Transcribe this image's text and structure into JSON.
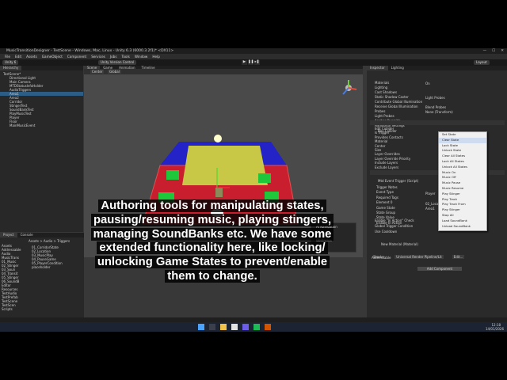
{
  "window": {
    "title": "MusicTransitionDesigner - TestScene - Windows, Mac, Linux - Unity 6.3 (6000.3.2f1)* <DX11>",
    "minimize": "—",
    "maximize": "☐",
    "close": "✕"
  },
  "menu": [
    "File",
    "Edit",
    "Assets",
    "GameObject",
    "Component",
    "Services",
    "Jobs",
    "Tools",
    "Window",
    "Help"
  ],
  "toolbar": {
    "unity_label": "Unity 6",
    "vc_label": "Unity Version Control",
    "layout_label": "Layout"
  },
  "hierarchy": {
    "tab": "Hierarchy",
    "items": [
      {
        "label": "TestScene*",
        "selected": false
      },
      {
        "label": "Directional Light",
        "selected": false
      },
      {
        "label": "Main Camera",
        "selected": false
      },
      {
        "label": "MTDStatusInfoHolder",
        "selected": false
      },
      {
        "label": "AudioTriggers",
        "selected": false
      },
      {
        "label": "Area1",
        "selected": true
      },
      {
        "label": "Area2",
        "selected": false
      },
      {
        "label": "Corridor",
        "selected": false
      },
      {
        "label": "StingerTest",
        "selected": false
      },
      {
        "label": "SoundBankTest",
        "selected": false
      },
      {
        "label": "PlayMusicTest",
        "selected": false
      },
      {
        "label": "Player",
        "selected": false
      },
      {
        "label": "Floor",
        "selected": false
      },
      {
        "label": "MainMusicEvent",
        "selected": false
      }
    ]
  },
  "scene": {
    "tabs": [
      "Scene",
      "Game",
      "Animation",
      "Timeline"
    ],
    "shading_mode": "Center",
    "space_mode": "Global",
    "overlay": {
      "title": "AI Navigation",
      "items": [
        "Surfaces",
        "Agents",
        "Obstacles"
      ]
    },
    "colors": {
      "background": "#4a4a4a",
      "blue": "#2323c8",
      "red": "#c81e2d",
      "yellow": "#c8c846",
      "green": "#1fc83a"
    }
  },
  "project": {
    "tabs": [
      "Project",
      "Console"
    ],
    "breadcrumb": "Assets > Audio > Triggers",
    "tree": [
      "Assets",
      "Addressable",
      "Audio",
      "MusicTrans",
      "01_Music",
      "02_Stinger",
      "03_Soun",
      "04_Transit",
      "05_Stinger",
      "06_SoundB",
      "Editor",
      "Resources",
      "TestAudio",
      "TestPrefab",
      "TestScene",
      "TestScen",
      "Scripts"
    ],
    "files": [
      "01_CorridorState",
      "02_Location",
      "03_MusicPlay",
      "04_PauseGame",
      "05_PlayerCondition",
      "placeholder"
    ]
  },
  "inspector": {
    "tabs": [
      "Inspector",
      "Lighting"
    ],
    "sections": [
      {
        "label": "Materials",
        "value": ""
      },
      {
        "label": "Lighting",
        "value": ""
      },
      {
        "label": "Cast Shadows",
        "value": "On"
      },
      {
        "label": "Static Shadow Caster",
        "value": ""
      },
      {
        "label": "Contribute Global Illumination",
        "value": ""
      },
      {
        "label": "Receive Global Illumination",
        "value": "Light Probes"
      },
      {
        "label": "Probes",
        "value": ""
      },
      {
        "label": "Light Probes",
        "value": "Blend Probes"
      },
      {
        "label": "Anchor Override",
        "value": "None (Transform)"
      },
      {
        "label": "Additional Settings",
        "value": ""
      }
    ],
    "box_collider": {
      "title": "Box Collider",
      "fields": [
        "Edit Collider",
        "Is Trigger",
        "Provides Contacts",
        "Material",
        "Center",
        "Size",
        "Layer Overrides",
        "Layer Override Priority",
        "Include Layers",
        "Exclude Layers"
      ]
    },
    "trigger": {
      "title": "Mtd Event Trigger (Script)",
      "rows": [
        {
          "label": "Trigger Notes",
          "value": ""
        },
        {
          "label": "Event Type",
          "value": ""
        },
        {
          "label": "Required Tags",
          "value": ""
        },
        {
          "label": "Element 0",
          "value": "Player"
        },
        {
          "label": "Game State",
          "value": ""
        },
        {
          "label": "State Group",
          "value": "02_Location (Game State)"
        },
        {
          "label": "State Value",
          "value": "Area1"
        },
        {
          "label": "Enable In Action",
          "value": ""
        }
      ]
    },
    "checks": [
      "Enable \"In Action\" Check",
      "Global Trigger Condition",
      "Use Cooldown"
    ],
    "material": {
      "name": "New Material (Material)",
      "shader_label": "Shader",
      "shader_value": "Universal Render Pipeline/Lit",
      "edit": "Edit..."
    },
    "addressable": "Addressable",
    "add_component": "Add Component",
    "dropdown": {
      "items": [
        "Set State",
        "Clear State",
        "Lock State",
        "Unlock State",
        "Clear All States",
        "Lock All States",
        "Unlock All States",
        "Music On",
        "Music Off",
        "Music Pause",
        "Music Resume",
        "Play Stinger",
        "Play Track",
        "Play Track From",
        "Play Stinger",
        "Stop All",
        "Load SoundBank",
        "Unload SoundBank"
      ],
      "highlighted": "Clear State"
    }
  },
  "status": {
    "message": "SoundBank '04_TestSoundBank' populated successfully."
  },
  "taskbar": {
    "time": "12:18",
    "date": "14/01/2026"
  },
  "caption": {
    "lines": [
      "Authoring tools for manipulating states,",
      "pausing/resuming music, playing stingers,",
      "managing SoundBanks etc. We have some",
      "extended functionality here, like locking/",
      "unlocking Game States to prevent/enable",
      "them to change."
    ]
  }
}
